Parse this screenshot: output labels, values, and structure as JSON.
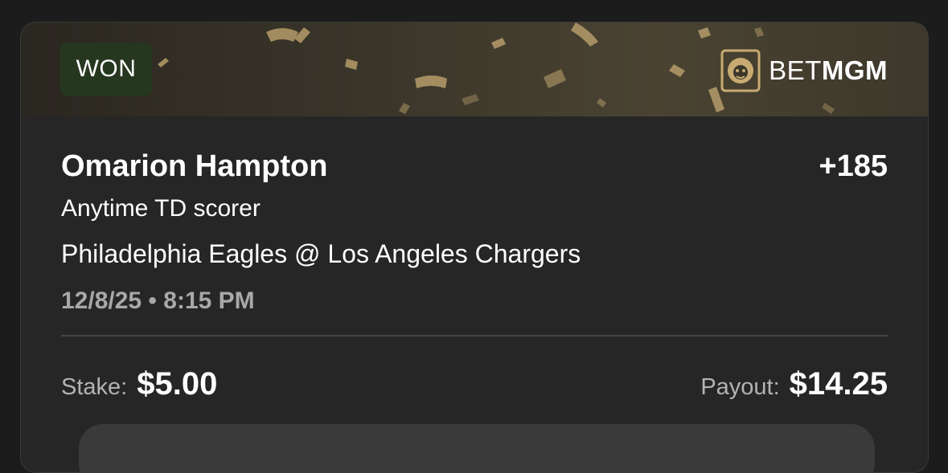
{
  "bet_card": {
    "status": "WON",
    "brand": {
      "name_light": "BET",
      "name_bold": "MGM",
      "logo": "lion-logo-icon"
    },
    "selection": {
      "player": "Omarion Hampton",
      "odds": "+185",
      "market": "Anytime TD scorer",
      "matchup": "Philadelphia Eagles @ Los Angeles Chargers",
      "datetime": "12/8/25 • 8:15 PM"
    },
    "stake": {
      "label": "Stake:",
      "value": "$5.00"
    },
    "payout": {
      "label": "Payout:",
      "value": "$14.25"
    }
  },
  "colors": {
    "page_bg": "#1c1c1c",
    "card_bg": "#262626",
    "won_badge": "#26371f",
    "confetti_gold": "#c2a878"
  }
}
